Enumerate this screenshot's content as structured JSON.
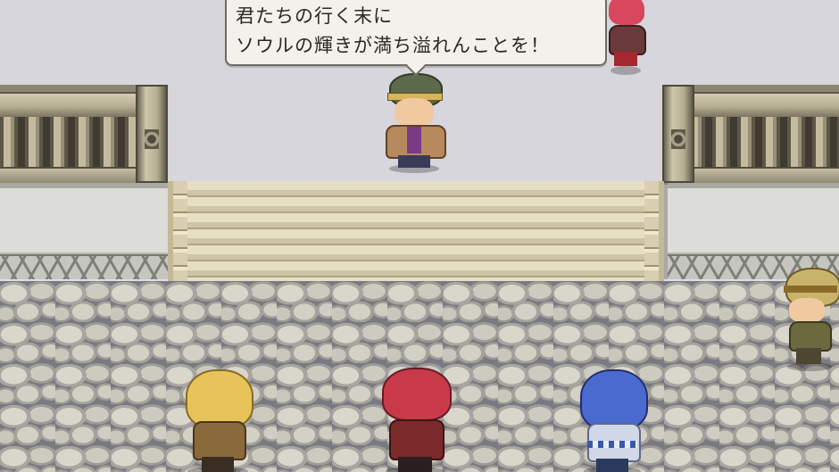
{
  "dialogue": {
    "lines": [
      "君たちの行く末に",
      "ソウルの輝きが満ち溢れんことを！"
    ]
  },
  "characters": [
    {
      "id": "speaker",
      "role": "npc-elder",
      "hair_color": "#5a6a4a",
      "outfit_color": "#b68a5c"
    },
    {
      "id": "red-haired-top",
      "role": "npc",
      "hair_color": "#d8485c",
      "outfit_color": "#6a3a3a"
    },
    {
      "id": "right-visitor",
      "role": "npc",
      "hair_color": "#c9b36a",
      "outfit_color": "#6b6a3e"
    },
    {
      "id": "blonde-hero",
      "role": "party-member",
      "hair_color": "#e8c35a",
      "outfit_color": "#8a6a3a"
    },
    {
      "id": "red-hero",
      "role": "party-member",
      "hair_color": "#c83a4a",
      "outfit_color": "#7a2a2a"
    },
    {
      "id": "blue-hero",
      "role": "party-member",
      "hair_color": "#4a6ad0",
      "outfit_color": "#d0d8e8"
    }
  ],
  "colors": {
    "floor_tile": "#f4f4f6",
    "stone": "#8d8672",
    "cobble": "#7a7a82",
    "stairs": "#e7dfc4"
  }
}
